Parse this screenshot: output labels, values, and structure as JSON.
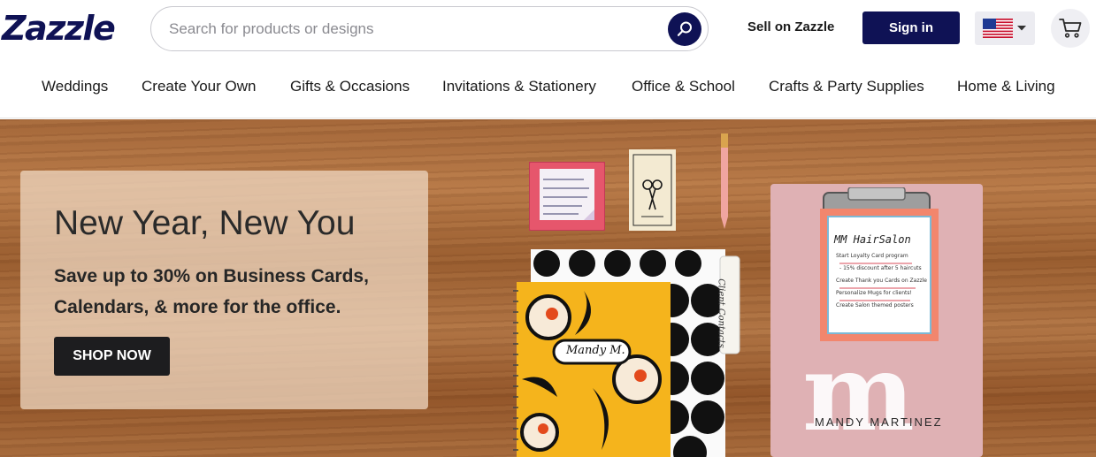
{
  "brand": {
    "logo_text": "Zazzle",
    "brand_color": "#0f1255"
  },
  "search": {
    "placeholder": "Search for products or designs",
    "value": "",
    "icon": "search-icon"
  },
  "header": {
    "sell_link": "Sell on Zazzle",
    "sign_in": "Sign in",
    "locale_icon": "us-flag-icon",
    "cart_icon": "cart-icon"
  },
  "nav": {
    "items": [
      "Weddings",
      "Create Your Own",
      "Gifts & Occasions",
      "Invitations & Stationery",
      "Office & School",
      "Crafts & Party Supplies",
      "Home & Living"
    ]
  },
  "hero": {
    "title": "New Year, New You",
    "subtitle": "Save up to 30% on Business Cards, Calendars, & more for the office.",
    "cta": "SHOP NOW",
    "products": {
      "notebook_name": "Mandy M.",
      "folder_tab": "Client Contacts",
      "clipboard_heading": "MM HairSalon",
      "clipboard_lines": [
        "Start Loyalty Card program",
        "- 15% discount after 5 haircuts",
        "Create Thank you Cards on Zazzle",
        "Personalize Mugs for clients!",
        "Create Salon themed posters"
      ],
      "clipboard_monogram": "m",
      "clipboard_name": "MANDY MARTINEZ"
    }
  }
}
